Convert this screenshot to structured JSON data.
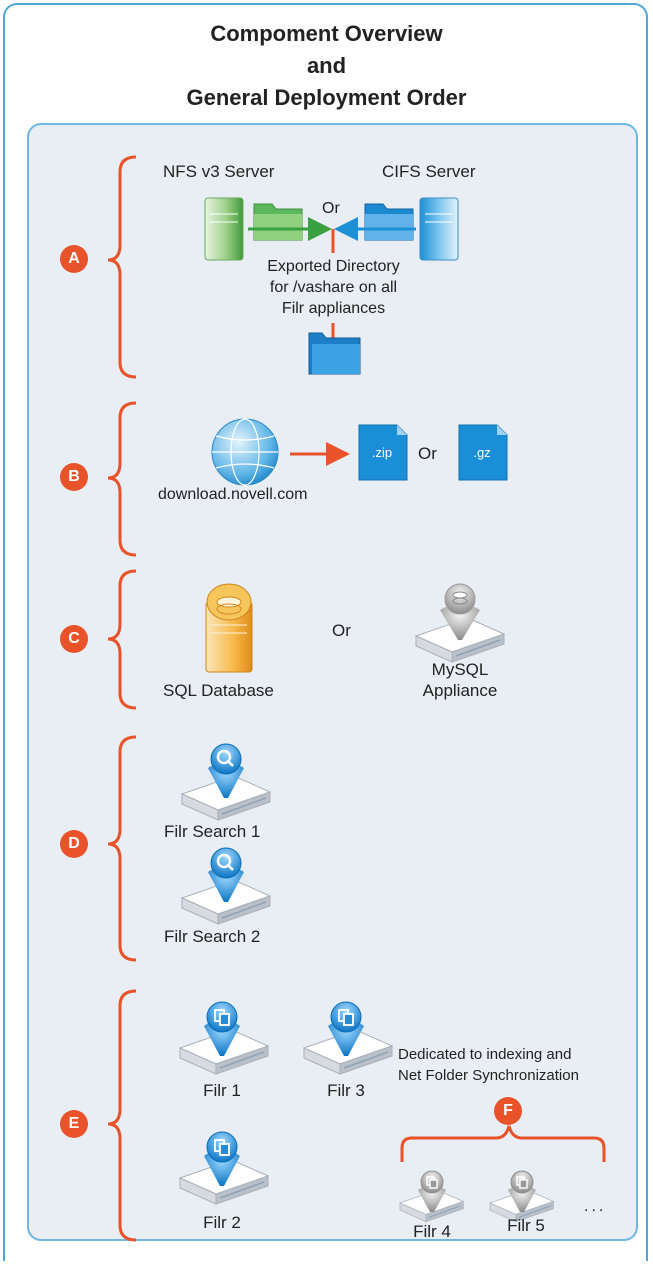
{
  "title": {
    "line1": "Compoment Overview",
    "line2": "and",
    "line3": "General Deployment Order"
  },
  "colors": {
    "accent": "#e8532a",
    "frame": "#4fa8d8",
    "panel_bg": "#e9eef4",
    "nfs_green": "#3aa040",
    "cifs_blue": "#1e90d6"
  },
  "sections": {
    "a": {
      "badge": "A",
      "nfs_server": "NFS v3 Server",
      "cifs_server": "CIFS Server",
      "or": "Or",
      "exported_line1": "Exported Directory",
      "exported_line2": "for /vashare on all",
      "exported_line3": "Filr appliances"
    },
    "b": {
      "badge": "B",
      "source": "download.novell.com",
      "zip": ".zip",
      "gz": ".gz",
      "or": "Or"
    },
    "c": {
      "badge": "C",
      "sql": "SQL Database",
      "or": "Or",
      "mysql_line1": "MySQL",
      "mysql_line2": "Appliance"
    },
    "d": {
      "badge": "D",
      "search1": "Filr Search 1",
      "search2": "Filr Search 2"
    },
    "e": {
      "badge": "E",
      "filr1": "Filr 1",
      "filr2": "Filr 2",
      "filr3": "Filr 3",
      "dedicated_line1": "Dedicated to indexing and",
      "dedicated_line2": "Net Folder Synchronization"
    },
    "f": {
      "badge": "F",
      "filr4": "Filr 4",
      "filr5": "Filr 5",
      "ellipsis": "..."
    }
  }
}
